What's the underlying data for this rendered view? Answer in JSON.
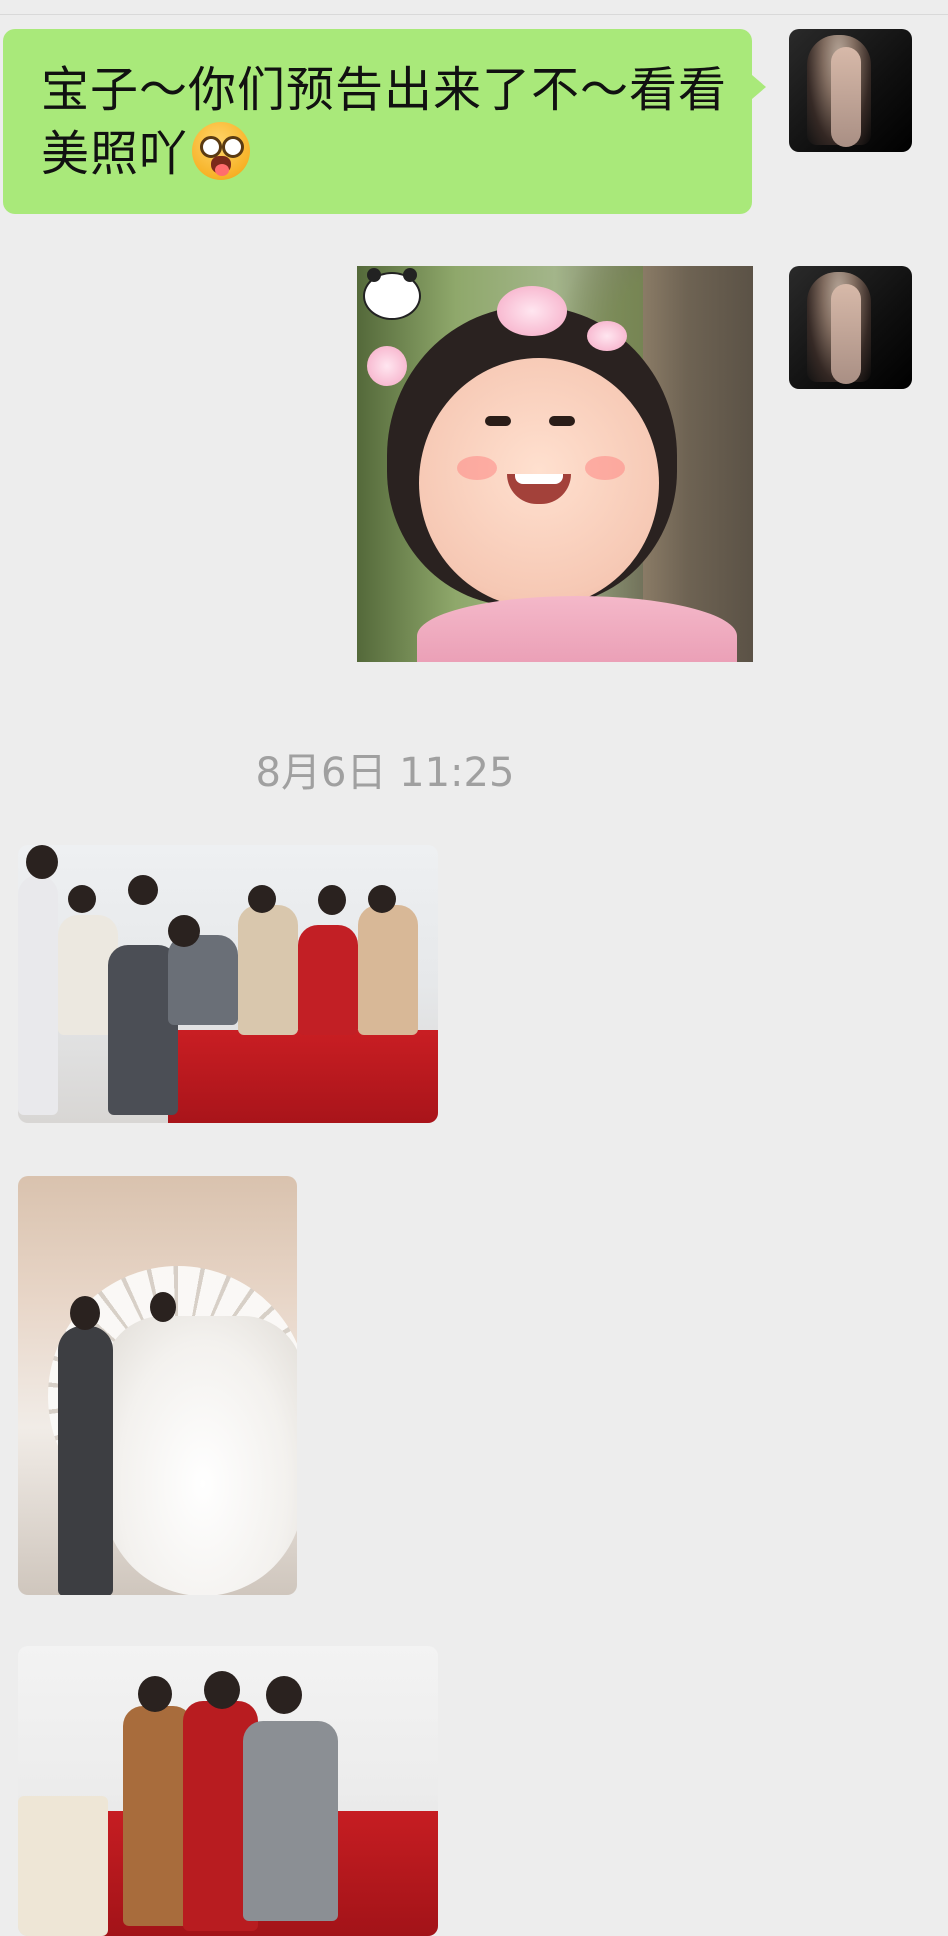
{
  "conversation": {
    "messages": [
      {
        "type": "text",
        "sender": "self",
        "text_main": "宝子～你们预告出来了不～看看美照吖",
        "emoji": "star-struck-tongue-emoji"
      },
      {
        "type": "image",
        "sender": "self",
        "image_description": "smiling-child-in-pink-hanfu"
      }
    ],
    "timestamp": "8月6日 11:25",
    "received_images": [
      {
        "type": "image",
        "sender": "other",
        "image_description": "wedding-group-photo"
      },
      {
        "type": "image",
        "sender": "other",
        "image_description": "bride-and-groom-portrait"
      },
      {
        "type": "image",
        "sender": "other",
        "image_description": "family-wedding-portrait"
      }
    ]
  },
  "colors": {
    "background": "#ededed",
    "self_bubble": "#a9e97a",
    "timestamp_text": "#a0a0a0"
  }
}
